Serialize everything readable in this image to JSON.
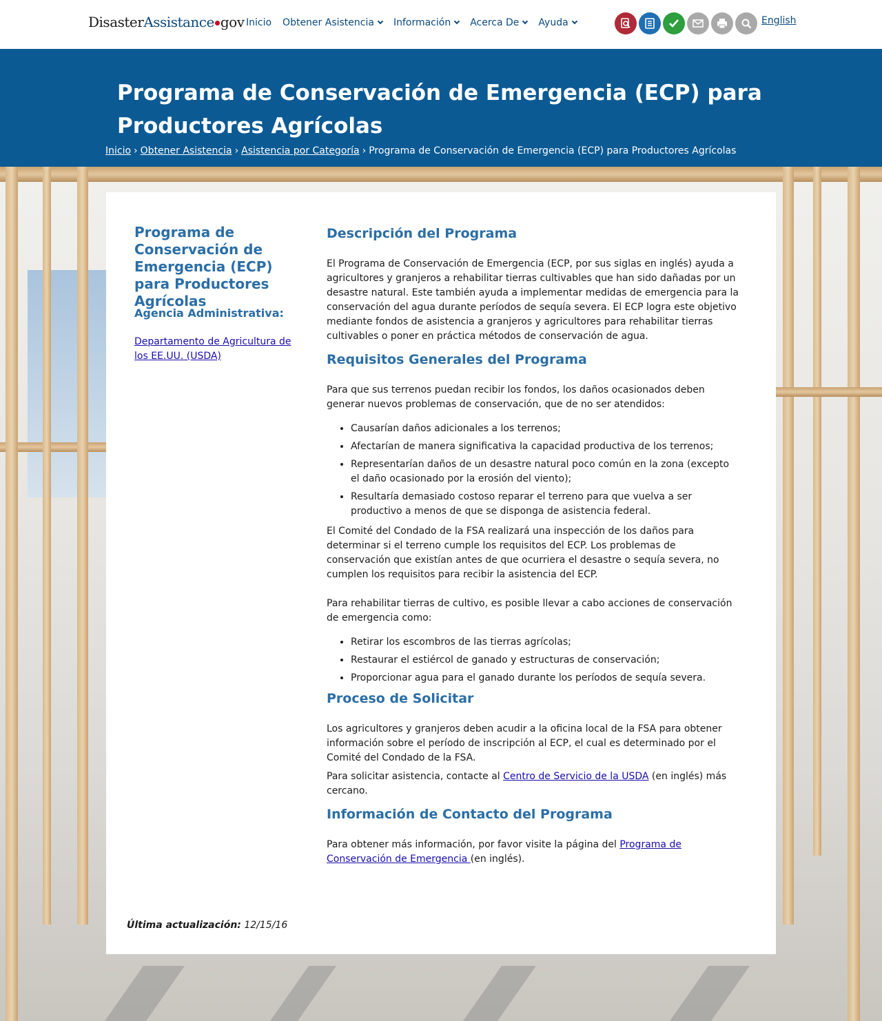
{
  "header": {
    "logo": {
      "part1": "Disaster",
      "part2": "Assistance",
      "part3": "gov"
    },
    "nav": [
      {
        "label": "Inicio",
        "dropdown": false
      },
      {
        "label": "Obtener Asistencia",
        "dropdown": true
      },
      {
        "label": "Información",
        "dropdown": true
      },
      {
        "label": "Acerca De",
        "dropdown": true
      },
      {
        "label": "Ayuda",
        "dropdown": true
      }
    ],
    "tools": [
      {
        "icon": "search-document-icon",
        "color": "#b02a37"
      },
      {
        "icon": "checklist-icon",
        "color": "#1f6fb2"
      },
      {
        "icon": "checkmark-icon",
        "color": "#2e9e3f"
      },
      {
        "icon": "email-icon",
        "color": "#a9a9a9"
      },
      {
        "icon": "print-icon",
        "color": "#a9a9a9"
      },
      {
        "icon": "magnifier-icon",
        "color": "#a9a9a9"
      }
    ],
    "language_link": "English"
  },
  "banner": {
    "title": "Programa de Conservación de Emergencia (ECP) para Productores Agrícolas",
    "breadcrumb": {
      "home": "Inicio",
      "get_assistance": "Obtener Asistencia",
      "by_category": "Asistencia por Categoría",
      "current": "Programa de Conservación de Emergencia (ECP) para Productores Agrícolas",
      "separator": "›"
    }
  },
  "sidebar": {
    "title": "Programa de Conservación de Emergencia (ECP) para Productores Agrícolas",
    "agency_label": "Agencia Administrativa:",
    "agency_link": "Departamento de Agricultura de los EE.UU. (USDA)"
  },
  "main": {
    "description": {
      "heading": "Descripción del Programa",
      "text": "El Programa de Conservación de Emergencia (ECP, por sus siglas en inglés) ayuda a agricultores y granjeros a rehabilitar tierras cultivables que han sido dañadas por un desastre natural. Este también ayuda a implementar medidas de emergencia para la conservación del agua durante períodos de sequía severa. El ECP logra este objetivo mediante fondos de asistencia a granjeros y agricultores para rehabilitar tierras cultivables o poner en práctica métodos de conservación de agua."
    },
    "requirements": {
      "heading": "Requisitos Generales del Programa",
      "intro": "Para que sus terrenos puedan recibir los fondos, los daños ocasionados deben generar nuevos problemas de conservación, que de no ser atendidos:",
      "list1": [
        "Causarían daños adicionales a los terrenos;",
        "Afectarían de manera significativa la capacidad productiva de los terrenos;",
        "Representarían daños de un desastre natural poco común en la zona (excepto el daño ocasionado por la erosión del viento);",
        "Resultaría demasiado costoso reparar el terreno para que vuelva a ser productivo a menos de que se disponga de asistencia federal."
      ],
      "inspection": "El Comité del Condado de la FSA realizará una inspección de los daños para determinar si el terreno cumple los requisitos del ECP. Los problemas de conservación que existían antes de que ocurriera el desastre o sequía severa, no cumplen los requisitos para recibir la asistencia del ECP.",
      "actions_intro": "Para rehabilitar tierras de cultivo, es posible llevar a cabo acciones de conservación de emergencia como:",
      "list2": [
        "Retirar los escombros de las tierras agrícolas;",
        "Restaurar el estiércol de ganado y estructuras de conservación;",
        "Proporcionar agua para el ganado durante los períodos de sequía severa."
      ]
    },
    "process": {
      "heading": "Proceso de Solicitar",
      "text1": "Los agricultores y granjeros deben acudir a la oficina local de la FSA para obtener información sobre el período de inscripción al ECP, el cual es determinado por el Comité del Condado de la FSA.",
      "text2_before": "Para solicitar asistencia, contacte al ",
      "text2_link": "Centro de Servicio de la USDA",
      "text2_after": " (en inglés) más cercano."
    },
    "contact": {
      "heading": "Información de Contacto del Programa",
      "text_before": "Para obtener más información, por favor visite la página del ",
      "link": "Programa de Conservación de Emergencia ",
      "text_after": "(en inglés)."
    }
  },
  "footer": {
    "updated_label": "Última actualización:",
    "updated_date": "12/15/16"
  }
}
